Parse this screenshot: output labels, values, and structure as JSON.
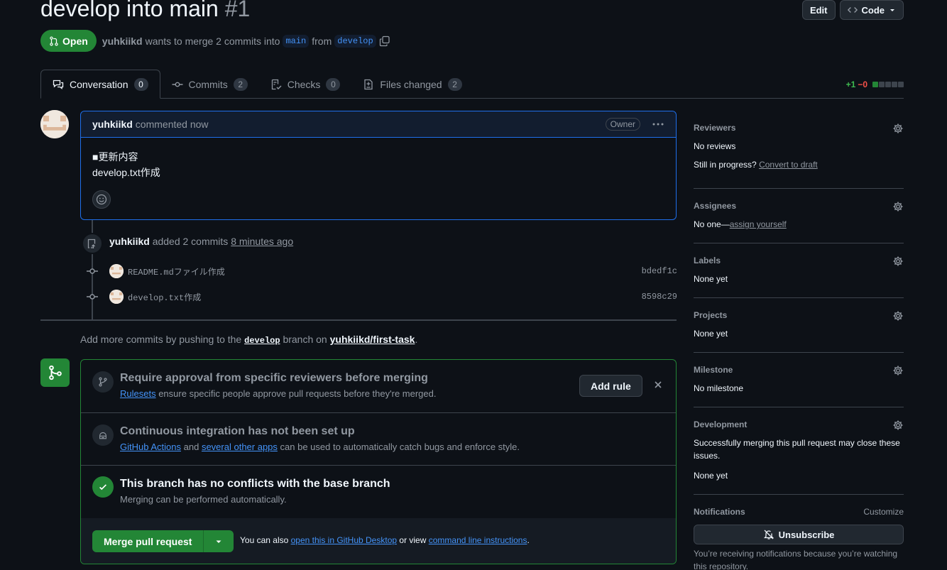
{
  "header": {
    "title": "develop into main",
    "number": "#1",
    "edit_label": "Edit",
    "code_label": "Code"
  },
  "state": {
    "badge": "Open",
    "author": "yuhkiikd",
    "text_mid": "wants to merge 2 commits into",
    "base_branch": "main",
    "from": "from",
    "head_branch": "develop"
  },
  "tabs": [
    {
      "label": "Conversation",
      "count": "0"
    },
    {
      "label": "Commits",
      "count": "2"
    },
    {
      "label": "Checks",
      "count": "0"
    },
    {
      "label": "Files changed",
      "count": "2"
    }
  ],
  "diffstat": {
    "additions": "+1",
    "deletions": "−0",
    "filled": 1,
    "total": 5
  },
  "comment": {
    "author": "yuhkiikd",
    "action": "commented now",
    "role": "Owner",
    "body_line1": "■更新内容",
    "body_line2": "develop.txt作成"
  },
  "timeline": {
    "actor": "yuhkiikd",
    "action": "added 2 commits",
    "time": "8 minutes ago",
    "commits": [
      {
        "message": "README.mdファイル作成",
        "sha": "bdedf1c"
      },
      {
        "message": "develop.txt作成",
        "sha": "8598c29"
      }
    ]
  },
  "push_note": {
    "prefix": "Add more commits by pushing to the",
    "branch": "develop",
    "mid": "branch on",
    "repo": "yuhkiikd/first-task",
    "suffix": "."
  },
  "merge_box": {
    "rule_title": "Require approval from specific reviewers before merging",
    "rule_link": "Rulesets",
    "rule_sub": "ensure specific people approve pull requests before they're merged.",
    "add_rule_label": "Add rule",
    "ci_title": "Continuous integration has not been set up",
    "ci_link1": "GitHub Actions",
    "ci_and": "and",
    "ci_link2": "several other apps",
    "ci_sub": "can be used to automatically catch bugs and enforce style.",
    "conflict_title": "This branch has no conflicts with the base branch",
    "conflict_sub": "Merging can be performed automatically.",
    "merge_label": "Merge pull request",
    "alt_prefix": "You can also",
    "alt_link1": "open this in GitHub Desktop",
    "alt_mid": "or view",
    "alt_link2": "command line instructions",
    "alt_suffix": "."
  },
  "sidebar": {
    "reviewers": {
      "title": "Reviewers",
      "value": "No reviews",
      "draft_prefix": "Still in progress?",
      "draft_link": "Convert to draft"
    },
    "assignees": {
      "title": "Assignees",
      "value": "No one—",
      "link": "assign yourself"
    },
    "labels": {
      "title": "Labels",
      "value": "None yet"
    },
    "projects": {
      "title": "Projects",
      "value": "None yet"
    },
    "milestone": {
      "title": "Milestone",
      "value": "No milestone"
    },
    "development": {
      "title": "Development",
      "desc": "Successfully merging this pull request may close these issues.",
      "value": "None yet"
    },
    "notifications": {
      "title": "Notifications",
      "customize": "Customize",
      "unsubscribe": "Unsubscribe",
      "note": "You’re receiving notifications because you’re watching this repository."
    }
  },
  "colors": {
    "accent": "#4493f8",
    "success": "#238636",
    "background": "#0d1117",
    "border": "#3d444d"
  }
}
